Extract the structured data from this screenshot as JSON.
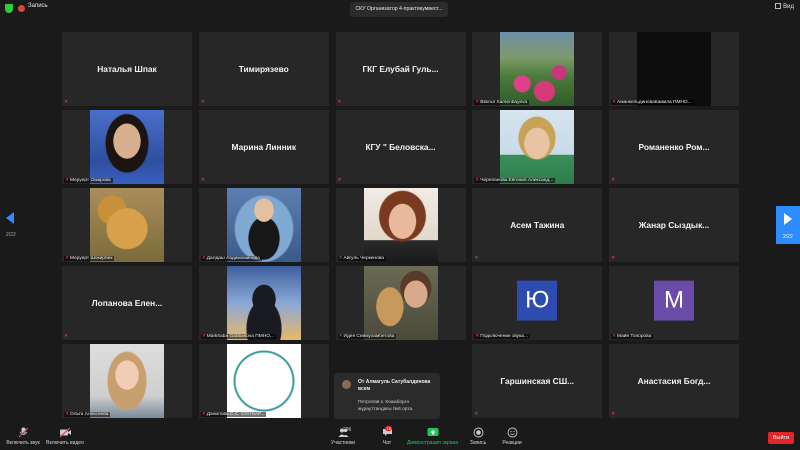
{
  "topbar": {
    "record_label": "Запись",
    "meeting_title": "СКУ Организатор 4-практикумвест...",
    "view_label": "Вид"
  },
  "nav": {
    "left_page": "2/22",
    "right_page": "2/22"
  },
  "participants": [
    {
      "name": "Наталья Шпак",
      "type": "name"
    },
    {
      "name": "Тимирязево",
      "type": "name"
    },
    {
      "name": "ГКГ Елубай Гуль...",
      "type": "name"
    },
    {
      "caption": "Bibinur Sarsenbayeva",
      "type": "photo",
      "photo": "flowers"
    },
    {
      "caption": "АманкельдиноваКамила ПМНО...",
      "type": "photo",
      "photo": "dark"
    },
    {
      "caption": "Меруерт Омарова",
      "type": "photo",
      "photo": "portrait1"
    },
    {
      "name": "Марина Линник",
      "type": "name"
    },
    {
      "name": "КГУ \" Беловска...",
      "type": "name"
    },
    {
      "caption": "Черепанова Евгения Александ...",
      "type": "photo",
      "photo": "portrait2"
    },
    {
      "name": "Романенко Ром...",
      "type": "name"
    },
    {
      "caption": "Меруерт Шокирбек",
      "type": "photo",
      "photo": "cheetah"
    },
    {
      "caption": "Далдаш Абдимоминова",
      "type": "photo",
      "photo": "chair"
    },
    {
      "caption": "Айгуль Черкенова",
      "type": "photo",
      "photo": "portrait3"
    },
    {
      "name": "Асем Тажина",
      "type": "name"
    },
    {
      "name": "Жанар Сыздык...",
      "type": "name"
    },
    {
      "name": "Лопанова Елен...",
      "type": "name"
    },
    {
      "caption": "Markhaba Gabbasova ПМНО...",
      "type": "photo",
      "photo": "silhouette"
    },
    {
      "caption": "Идея Сеймухамбетова",
      "type": "photo",
      "photo": "teddy"
    },
    {
      "caption": "Подключение звука...",
      "type": "letter",
      "letter": "Ю",
      "color": "#2d4bb0"
    },
    {
      "caption": "Майя Топорова",
      "type": "letter",
      "letter": "М",
      "color": "#6b4ba8"
    },
    {
      "caption": "Ольга Алексеева",
      "type": "photo",
      "photo": "girl"
    },
    {
      "caption": "Данилова С.С. СУН КАР...",
      "type": "photo",
      "photo": "logo"
    },
    {
      "type": "empty"
    },
    {
      "name": "Гаршинская СШ...",
      "type": "name"
    },
    {
      "name": "Анастасия Богд...",
      "type": "name"
    }
  ],
  "chat_popup": {
    "from": "От Алмагуль Сатубалдинова всем",
    "message": "Петропав к. Кожабергн жұрауттандағы №6 орта."
  },
  "toolbar": {
    "mute_label": "Включить звук",
    "video_label": "Включить видео",
    "participants_label": "Участники",
    "participants_count": "296",
    "chat_label": "Чат",
    "chat_badge": "78",
    "share_label": "Демонстрация экрана",
    "record_label": "Запись",
    "reactions_label": "Реакции",
    "end_label": "Выйти"
  },
  "colors": {
    "accent": "#2d8cff",
    "share_green": "#1ec85a",
    "end_red": "#e02828",
    "tile_bg": "#272727",
    "page_bg": "#1a1a1a"
  }
}
